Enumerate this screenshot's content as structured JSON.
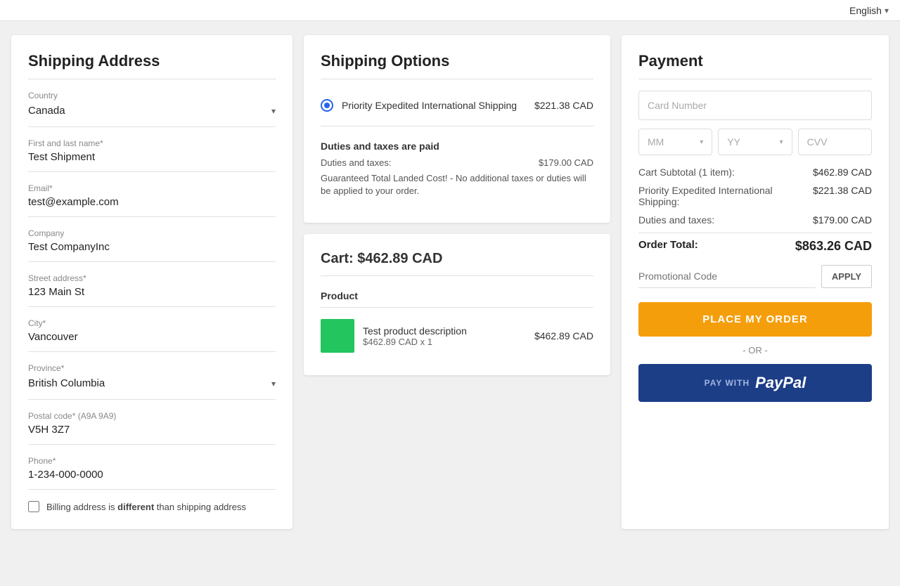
{
  "topbar": {
    "language_label": "English",
    "language_chevron": "▾"
  },
  "shipping_address": {
    "title": "Shipping Address",
    "country_label": "Country",
    "country_value": "Canada",
    "name_label": "First and last name*",
    "name_value": "Test Shipment",
    "email_label": "Email*",
    "email_value": "test@example.com",
    "company_label": "Company",
    "company_value": "Test CompanyInc",
    "street_label": "Street address*",
    "street_value": "123 Main St",
    "city_label": "City*",
    "city_value": "Vancouver",
    "province_label": "Province*",
    "province_value": "British Columbia",
    "postal_label": "Postal code* (A9A 9A9)",
    "postal_value": "V5H 3Z7",
    "phone_label": "Phone*",
    "phone_value": "1-234-000-0000",
    "billing_checkbox_label_prefix": "Billing address is ",
    "billing_diff": "different",
    "billing_checkbox_label_suffix": " than shipping address"
  },
  "shipping_options": {
    "title": "Shipping Options",
    "options": [
      {
        "label": "Priority Expedited International Shipping",
        "price": "$221.38 CAD",
        "selected": true
      }
    ],
    "duties_title": "Duties and taxes are paid",
    "duties_row_label": "Duties and taxes:",
    "duties_row_value": "$179.00 CAD",
    "duties_note": "Guaranteed Total Landed Cost! - No additional taxes or duties will be applied to your order."
  },
  "cart": {
    "title_prefix": "Cart: ",
    "cart_total": "$462.89 CAD",
    "product_col_header": "Product",
    "items": [
      {
        "name": "Test product description",
        "unit": "$462.89 CAD x 1",
        "price": "$462.89 CAD",
        "image_color": "#22c55e"
      }
    ]
  },
  "payment": {
    "title": "Payment",
    "card_number_placeholder": "Card Number",
    "mm_placeholder": "MM",
    "yy_placeholder": "YY",
    "cvv_placeholder": "CVV",
    "cart_subtotal_label": "Cart Subtotal (1 item):",
    "cart_subtotal_value": "$462.89 CAD",
    "shipping_label": "Priority Expedited International Shipping:",
    "shipping_value": "$221.38 CAD",
    "duties_label": "Duties and taxes:",
    "duties_value": "$179.00 CAD",
    "order_total_label": "Order Total:",
    "order_total_value": "$863.26 CAD",
    "promo_placeholder": "Promotional Code",
    "apply_button": "APPLY",
    "place_order_button": "PLACE MY ORDER",
    "or_label": "- OR -",
    "paypal_prefix": "PAY WITH",
    "paypal_brand": "PayPal"
  }
}
